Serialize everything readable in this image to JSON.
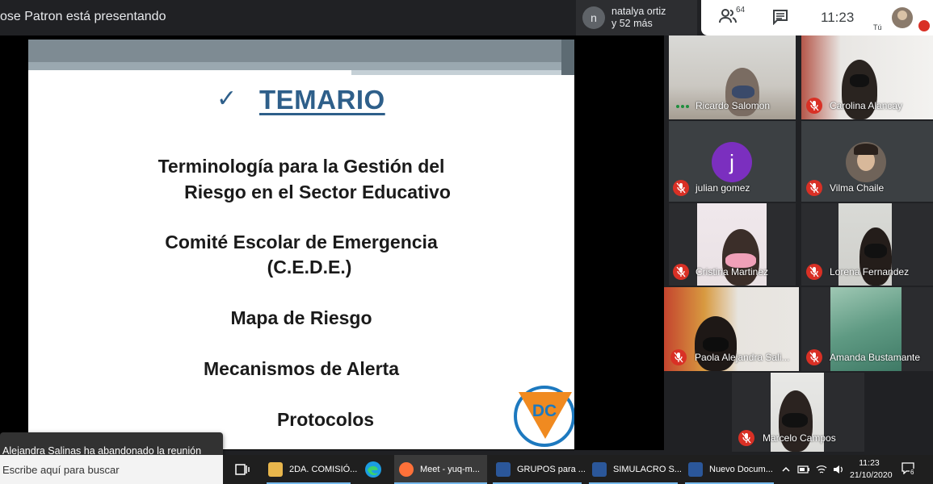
{
  "topbar": {
    "presenting_text": "ose Patron está presentando",
    "participants_chip": {
      "avatar_letter": "n",
      "line1": "natalya ortiz",
      "line2": "y 52 más"
    },
    "people_count": "64",
    "time": "11:23",
    "self_label": "Tú"
  },
  "slide": {
    "title": "TEMARIO",
    "check_glyph": "✓",
    "items": [
      "Terminología para la Gestión del",
      "Riesgo en el Sector Educativo",
      "Comité Escolar de Emergencia",
      "(C.E.D.E.)",
      "Mapa de Riesgo",
      "Mecanismos de Alerta",
      "Protocolos"
    ],
    "logo_text": "DC"
  },
  "toast": "Alejandra Salinas ha abandonado la reunión",
  "participants": [
    {
      "name": "Ricardo Salomon",
      "muted": false
    },
    {
      "name": "Carolina Alancay",
      "muted": true
    },
    {
      "name": "julian gomez",
      "muted": true,
      "avatar_letter": "j"
    },
    {
      "name": "Vilma Chaile",
      "muted": true
    },
    {
      "name": "Cristina Martinez",
      "muted": true
    },
    {
      "name": "Lorena Fernandez",
      "muted": true
    },
    {
      "name": "Paola Alejandra Sali...",
      "muted": true
    },
    {
      "name": "Amanda Bustamante",
      "muted": true
    },
    {
      "name": "Marcelo Campos",
      "muted": true
    }
  ],
  "taskbar": {
    "search_placeholder": "Escribe aquí para buscar",
    "apps": [
      {
        "label": "2DA. COMISIÓ...",
        "icon": "folder-icon",
        "color": "#e8b64c"
      },
      {
        "label": "Meet - yuq-m...",
        "icon": "firefox-icon",
        "color": "#ff7139"
      },
      {
        "label": "GRUPOS para ...",
        "icon": "word-doc-icon",
        "color": "#2b579a"
      },
      {
        "label": "SIMULACRO S...",
        "icon": "word-doc-icon",
        "color": "#2b579a"
      },
      {
        "label": "Nuevo Docum...",
        "icon": "word-doc-icon",
        "color": "#2b579a"
      }
    ],
    "clock_time": "11:23",
    "clock_date": "21/10/2020",
    "notification_count": "6"
  }
}
